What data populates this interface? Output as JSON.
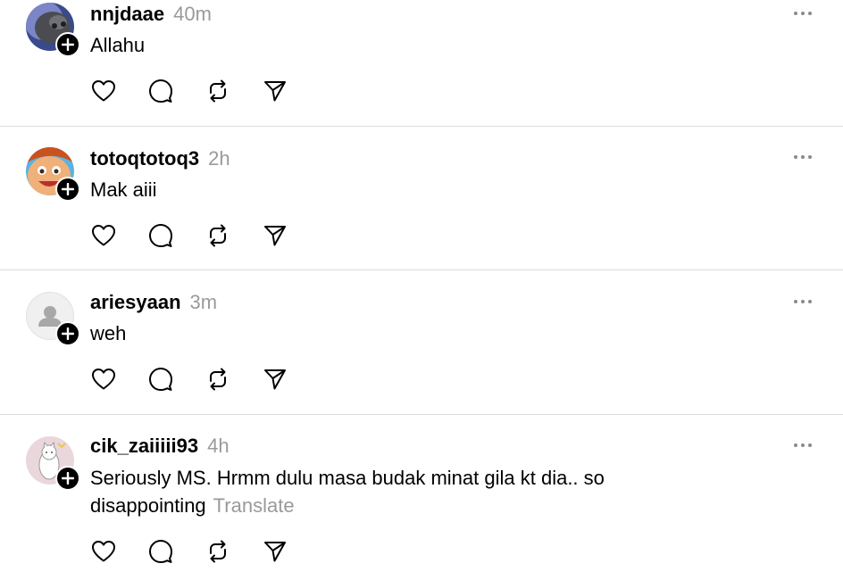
{
  "posts": [
    {
      "username": "nnjdaae",
      "time": "40m",
      "text": "Allahu",
      "translate": ""
    },
    {
      "username": "totoqtotoq3",
      "time": "2h",
      "text": "Mak aiii",
      "translate": ""
    },
    {
      "username": "ariesyaan",
      "time": "3m",
      "text": "weh",
      "translate": ""
    },
    {
      "username": "cik_zaiiiii93",
      "time": "4h",
      "text": "Seriously MS. Hrmm dulu masa budak minat gila kt dia.. so disappointing",
      "translate": "Translate"
    }
  ],
  "icons": {
    "like": "heart-icon",
    "reply": "comment-bubble-icon",
    "repost": "repost-icon",
    "share": "send-icon",
    "more": "more-dots-icon",
    "follow": "plus-icon"
  }
}
